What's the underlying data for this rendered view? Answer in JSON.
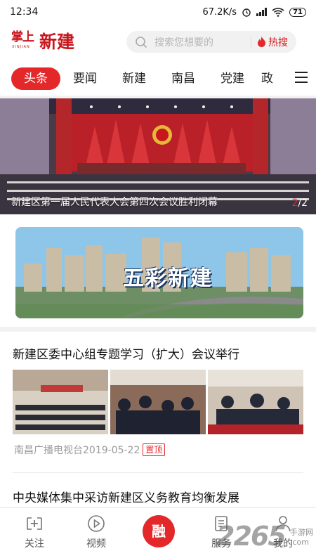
{
  "status": {
    "time": "12:34",
    "speed": "67.2K/s",
    "battery": "71"
  },
  "header": {
    "logo_small": "掌上",
    "logo_latin": "XINJIAN",
    "logo_big": "新建",
    "search_placeholder": "搜索您想要的",
    "hot_label": "热搜"
  },
  "tabs": [
    {
      "label": "头条",
      "active": true
    },
    {
      "label": "要闻"
    },
    {
      "label": "新建"
    },
    {
      "label": "南昌"
    },
    {
      "label": "党建"
    },
    {
      "label": "政"
    }
  ],
  "banner": {
    "caption": "新建区第一届人民代表大会第四次会议胜利闭幕",
    "page_current": "2",
    "page_total": "/2"
  },
  "promo": {
    "title": "五彩新建"
  },
  "news": [
    {
      "title": "新建区委中心组专题学习（扩大）会议举行",
      "source_date": "南昌广播电视台2019-05-22",
      "tag": "置顶"
    },
    {
      "title": "中央媒体集中采访新建区义务教育均衡发展"
    }
  ],
  "bottom_nav": [
    {
      "label": "关注",
      "icon": "follow-icon"
    },
    {
      "label": "视频",
      "icon": "video-icon"
    },
    {
      "label": "融",
      "icon": "rong-center-button"
    },
    {
      "label": "服务",
      "icon": "service-icon"
    },
    {
      "label": "我的",
      "icon": "profile-icon"
    }
  ],
  "watermark": {
    "big": "2265",
    "small1": "手游网",
    "small2": ".com"
  },
  "colors": {
    "accent": "#e4282a",
    "logo": "#c8161d"
  }
}
